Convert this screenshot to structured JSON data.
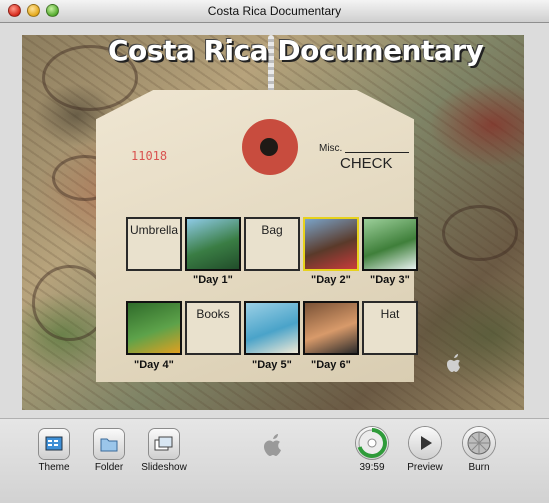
{
  "window": {
    "title": "Costa Rica Documentary"
  },
  "menu": {
    "title": "Costa Rica Documentary",
    "tag_number": "11018",
    "misc_label": "Misc.",
    "check_text": "CHECK"
  },
  "row1": [
    {
      "kind": "text",
      "label": "Umbrella"
    },
    {
      "kind": "image",
      "caption": "\"Day 1\"",
      "colors": [
        "#8ecae6",
        "#3a7d44",
        "#214d2a"
      ]
    },
    {
      "kind": "text",
      "label": "Bag"
    },
    {
      "kind": "image",
      "caption": "\"Day 2\"",
      "colors": [
        "#7aa3c8",
        "#5a3a2a",
        "#c93b3b"
      ],
      "selected": true
    },
    {
      "kind": "image",
      "caption": "\"Day 3\"",
      "colors": [
        "#9ccf9a",
        "#3f7f3a",
        "#e8f2f0"
      ]
    }
  ],
  "row2": [
    {
      "kind": "image",
      "caption": "\"Day 4\"",
      "colors": [
        "#2f6b2a",
        "#5da24a",
        "#e0a020"
      ]
    },
    {
      "kind": "text",
      "label": "Books"
    },
    {
      "kind": "image",
      "caption": "\"Day 5\"",
      "colors": [
        "#9bd0e6",
        "#4aa3c9",
        "#f1ead6"
      ]
    },
    {
      "kind": "image",
      "caption": "\"Day 6\"",
      "colors": [
        "#7a5236",
        "#d89a6a",
        "#2b2b2b"
      ]
    },
    {
      "kind": "text",
      "label": "Hat"
    }
  ],
  "toolbar": {
    "theme_label": "Theme",
    "folder_label": "Folder",
    "slideshow_label": "Slideshow",
    "time": "39:59",
    "preview_label": "Preview",
    "burn_label": "Burn"
  }
}
